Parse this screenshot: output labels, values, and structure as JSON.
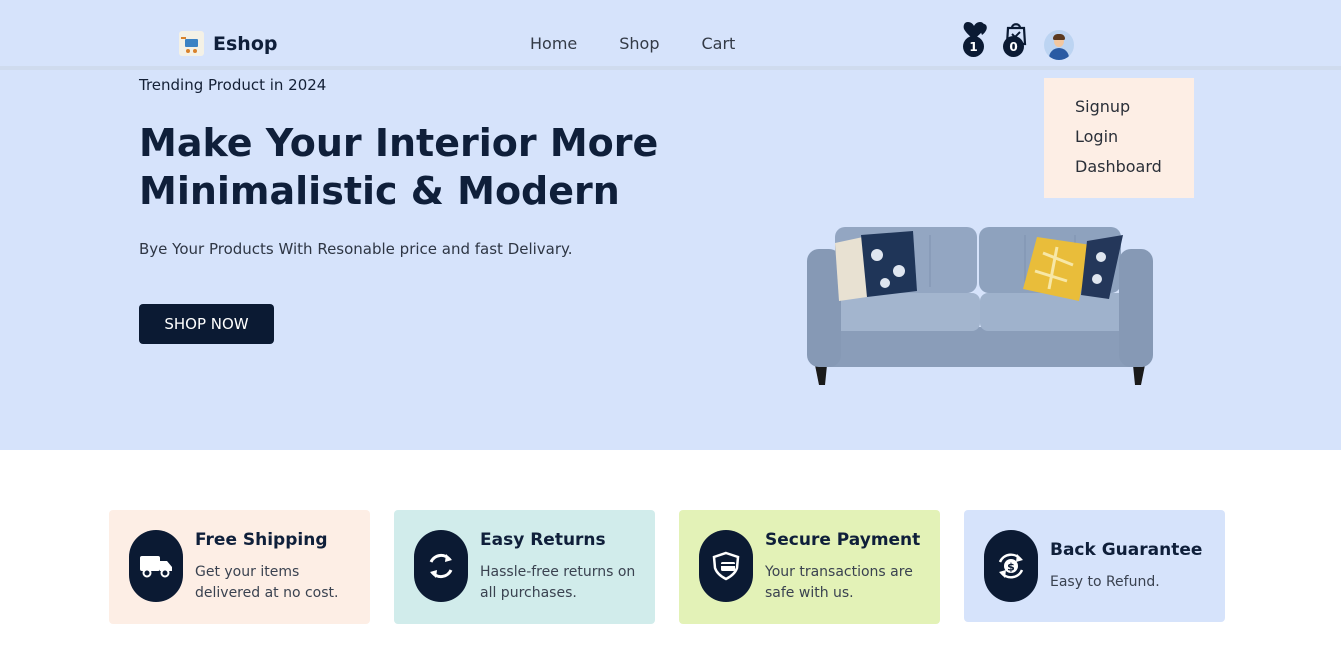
{
  "nav": {
    "brand": "Eshop",
    "links": [
      "Home",
      "Shop",
      "Cart"
    ],
    "wishlist_count": "1",
    "cart_count": "0"
  },
  "hero": {
    "eyebrow": "Trending Product in 2024",
    "title": "Make Your Interior More Minimalistic & Modern",
    "subtitle": "Bye Your Products With Resonable price and fast Delivary.",
    "cta": "SHOP NOW"
  },
  "user_menu": {
    "items": [
      "Signup",
      "Login",
      "Dashboard"
    ]
  },
  "features": [
    {
      "title": "Free Shipping",
      "desc": "Get your items delivered at no cost.",
      "icon": "truck-icon",
      "color": "#fdeee5"
    },
    {
      "title": "Easy Returns",
      "desc": "Hassle-free returns on all purchases.",
      "icon": "refresh-icon",
      "color": "#d1eceb"
    },
    {
      "title": "Secure Payment",
      "desc": "Your transactions are safe with us.",
      "icon": "shield-card-icon",
      "color": "#e3f2b7"
    },
    {
      "title": "Back Guarantee",
      "desc": "Easy to Refund.",
      "icon": "money-back-icon",
      "color": "#d6e3fb"
    }
  ],
  "colors": {
    "primary": "#0b1a33",
    "hero_bg": "#d6e3fb",
    "dropdown_bg": "#fdeee5"
  }
}
